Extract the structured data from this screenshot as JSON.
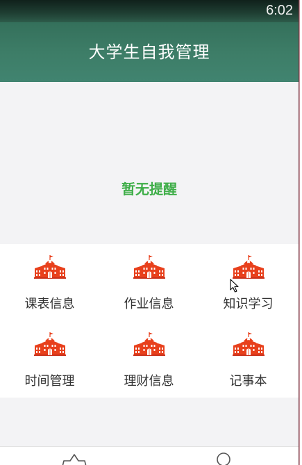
{
  "status_bar": {
    "time": "6:02"
  },
  "app_bar": {
    "title": "大学生自我管理"
  },
  "reminder": {
    "text": "暂无提醒"
  },
  "menu": {
    "items": [
      {
        "label": "课表信息",
        "icon": "school-building-icon"
      },
      {
        "label": "作业信息",
        "icon": "school-building-icon"
      },
      {
        "label": "知识学习",
        "icon": "school-building-icon"
      },
      {
        "label": "时间管理",
        "icon": "school-building-icon"
      },
      {
        "label": "理财信息",
        "icon": "school-building-icon"
      },
      {
        "label": "记事本",
        "icon": "school-building-icon"
      }
    ]
  },
  "bottom_nav": {
    "items": [
      {
        "icon": "home-icon"
      },
      {
        "icon": "profile-icon"
      }
    ]
  },
  "colors": {
    "app_bar": "#3d7d67",
    "reminder_text": "#3fae49",
    "icon": "#e8401c",
    "background": "#f3f3f5"
  }
}
